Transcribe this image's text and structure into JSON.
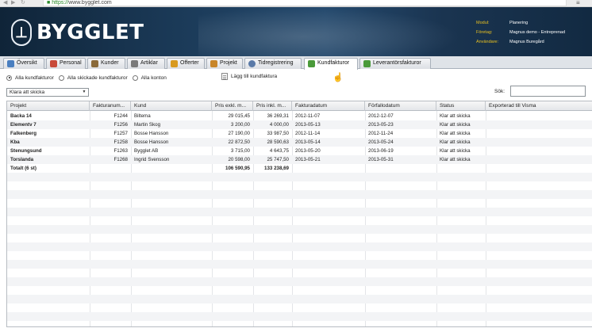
{
  "browser": {
    "url_scheme": "https://",
    "url_host": "www.bygglet.com"
  },
  "header": {
    "logo_text": "BYGGLET",
    "info": [
      {
        "label": "Modul:",
        "value": "Planering"
      },
      {
        "label": "Företag:",
        "value": "Magnus demo - Entreprenad"
      },
      {
        "label": "Användare:",
        "value": "Magnus Buregård"
      }
    ]
  },
  "tabs": [
    {
      "label": "Översikt",
      "icon": "overview-icon",
      "color": "#4a7fc0"
    },
    {
      "label": "Personal",
      "icon": "person-icon",
      "color": "#c84a3a"
    },
    {
      "label": "Kunder",
      "icon": "customers-icon",
      "color": "#8a6a3a"
    },
    {
      "label": "Artiklar",
      "icon": "articles-icon",
      "color": "#7a7a7a"
    },
    {
      "label": "Offerter",
      "icon": "offers-icon",
      "color": "#d89a20"
    },
    {
      "label": "Projekt",
      "icon": "project-icon",
      "color": "#c8862a"
    },
    {
      "label": "Tidregistrering",
      "icon": "clock-icon",
      "color": "#5a7aa8"
    },
    {
      "label": "Kundfakturor",
      "icon": "customer-invoice-icon",
      "color": "#4a9a3a",
      "active": true
    },
    {
      "label": "Leverantörsfakturor",
      "icon": "supplier-invoice-icon",
      "color": "#4a9a3a"
    }
  ],
  "filters": {
    "options": [
      {
        "label": "Alla kundfakturor",
        "selected": true
      },
      {
        "label": "Alla skickade kundfakturor",
        "selected": false
      },
      {
        "label": "Alla konton",
        "selected": false
      }
    ],
    "add_invoice_label": "Lägg till kundfaktura",
    "status_select": "Klara att skicka",
    "search_label": "Sök:",
    "search_value": ""
  },
  "table": {
    "columns": [
      "Projekt",
      "Fakturanum...",
      "Kund",
      "Pris exkl. m...",
      "Pris inkl. m...",
      "Fakturadatum",
      "Förfallodatum",
      "Status",
      "Exporterad till Visma"
    ],
    "rows": [
      [
        "Backa 14",
        "F1244",
        "Biltema",
        "29 015,45",
        "36 269,31",
        "2012-11-07",
        "2012-12-07",
        "Klar att skicka",
        ""
      ],
      [
        "Elementv 7",
        "F1256",
        "Martin Skog",
        "3 200,00",
        "4 000,00",
        "2013-05-13",
        "2013-05-23",
        "Klar att skicka",
        ""
      ],
      [
        "Falkenberg",
        "F1257",
        "Bosse Hansson",
        "27 190,00",
        "33 987,50",
        "2012-11-14",
        "2012-11-24",
        "Klar att skicka",
        ""
      ],
      [
        "Kba",
        "F1258",
        "Bosse Hansson",
        "22 872,50",
        "28 590,63",
        "2013-05-14",
        "2013-05-24",
        "Klar att skicka",
        ""
      ],
      [
        "Stenungsund",
        "F1263",
        "Bygglet AB",
        "3 715,00",
        "4 643,75",
        "2013-05-20",
        "2013-06-19",
        "Klar att skicka",
        ""
      ],
      [
        "Torslanda",
        "F1268",
        "Ingrid Svensson",
        "20 598,00",
        "25 747,50",
        "2013-05-21",
        "2013-05-31",
        "Klar att skicka",
        ""
      ]
    ],
    "total": [
      "Totalt (6 st)",
      "",
      "",
      "106 590,95",
      "133 238,69",
      "",
      "",
      "",
      ""
    ]
  }
}
